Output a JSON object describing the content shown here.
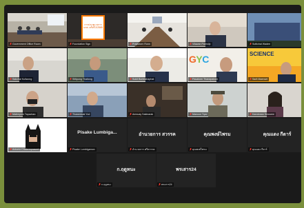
{
  "meeting": {
    "participants": [
      {
        "name": "Government Office Room",
        "display": "",
        "muted": true,
        "video": true
      },
      {
        "name": "Foundation Sign",
        "display": "",
        "muted": true,
        "video": true
      },
      {
        "name": "Prajaktorn Ronn",
        "display": "",
        "muted": true,
        "video": true
      },
      {
        "name": "Vilawan Parnsilp",
        "display": "",
        "muted": true,
        "video": true
      },
      {
        "name": "Suttichai Wadee",
        "display": "",
        "muted": true,
        "video": true
      },
      {
        "name": "Sakchai Kuliwong",
        "display": "",
        "muted": true,
        "video": true
      },
      {
        "name": "Sittipong Thaitong",
        "display": "",
        "muted": true,
        "video": true
      },
      {
        "name": "Sukit Burimahaphat",
        "display": "",
        "muted": true,
        "video": true
      },
      {
        "name": "Pasakorn Thanapakorn",
        "display": "",
        "muted": true,
        "video": true
      },
      {
        "name": "Sarit Maenset",
        "display": "",
        "muted": true,
        "video": true
      },
      {
        "name": "Maleeporn Tapachan",
        "display": "",
        "muted": true,
        "video": true
      },
      {
        "name": "Thaweesak Yod",
        "display": "",
        "muted": true,
        "video": true
      },
      {
        "name": "Amnuay Sakinarak",
        "display": "",
        "muted": true,
        "video": true
      },
      {
        "name": "Manoon Tipsi",
        "display": "",
        "muted": true,
        "video": true
      },
      {
        "name": "Kanokwan Sriwaree",
        "display": "",
        "muted": true,
        "video": true
      },
      {
        "name": "Antonio Chalermprasert",
        "display": "",
        "muted": true,
        "video": true
      },
      {
        "name": "Pisake Lumbigamon",
        "display": "Pisake Lumbiga...",
        "muted": true,
        "video": false
      },
      {
        "name": "อำนวยการ ศรีสวรรค",
        "display": "อำนวยการ สวรรค",
        "muted": true,
        "video": false
      },
      {
        "name": "คุณพงษ์ไพรม",
        "display": "คุณพงษ์ไพรม",
        "muted": true,
        "video": false
      },
      {
        "name": "คุณแดง กีตาร์",
        "display": "คุณแดง กีตาร์",
        "muted": true,
        "video": false
      },
      {
        "name": "ก.ฤดูหนะ",
        "display": "ก.ฤดูหนะ",
        "muted": true,
        "video": false
      },
      {
        "name": "พรเสาร24",
        "display": "พรเสาร24",
        "muted": true,
        "video": false
      }
    ],
    "active_speaker_index": 8,
    "colors": {
      "background": "#7a8f3c",
      "window": "#1a1a1a",
      "tile": "#232323",
      "active_border": "#f5e12a",
      "muted_icon": "#ff3b30"
    },
    "icons": {
      "muted": "microphone-muted-icon"
    }
  },
  "screen_text": {
    "sign": "การประชุม สภาฯ มกส. ครั้งที่ 2/2565",
    "gyc": "GYC",
    "science": "SCIENCE"
  }
}
